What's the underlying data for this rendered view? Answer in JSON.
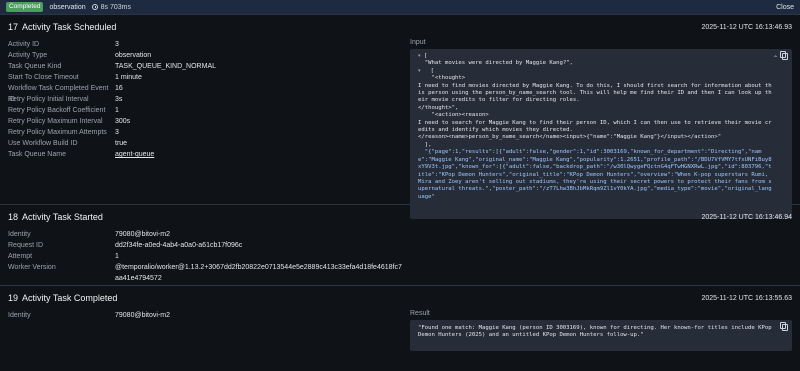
{
  "topbar": {
    "status": "Completed",
    "type": "observation",
    "duration": "8s 703ms",
    "close": "Close"
  },
  "sec17": {
    "num": "17",
    "title": "Activity Task Scheduled",
    "ts": "2025-11-12 UTC 16:13:46.93",
    "rows": [
      {
        "k": "Activity ID",
        "v": "3"
      },
      {
        "k": "Activity Type",
        "v": "observation"
      },
      {
        "k": "Task Queue Kind",
        "v": "TASK_QUEUE_KIND_NORMAL"
      },
      {
        "k": "Start To Close Timeout",
        "v": "1 minute"
      },
      {
        "k": "Workflow Task Completed Event ID",
        "v": "16"
      },
      {
        "k": "Retry Policy Initial Interval",
        "v": "3s"
      },
      {
        "k": "Retry Policy Backoff Coefficient",
        "v": "1"
      },
      {
        "k": "Retry Policy Maximum Interval",
        "v": "300s"
      },
      {
        "k": "Retry Policy Maximum Attempts",
        "v": "3"
      },
      {
        "k": "Use Workflow Build ID",
        "v": "true"
      },
      {
        "k": "Task Queue Name",
        "v": "agent-queue"
      }
    ],
    "input_label": "Input",
    "input_lines": [
      "[",
      "  \"What movies were directed by Maggie Kang?\",",
      "  [",
      "    \"<thought>",
      "I need to find movies directed by Maggie Kang. To do this, I should first search for information about this person using the person_by_name_search tool. This will help me find their ID and then I can look up their movie credits to filter for directing roles.",
      "</thought>\",",
      "    \"<action><reason>",
      "I need to search for Maggie Kang to find their person ID, which I can then use to retrieve their movie credits and identify which movies they directed.",
      "</reason><name>person_by_name_search</name><input>{\"name\":\"Maggie Kang\"}</input></action>\"",
      "  ],",
      "  \"{\"page\":1,\"results\":[{\"adult\":false,\"gender\":1,\"id\":3003169,\"known_for_department\":\"Directing\",\"name\":\"Maggie Kang\",\"original_name\":\"Maggie Kang\",\"popularity\":1.2651,\"profile_path\":\"/BDU7VfVMY7tfxUNFiBuy8xY9V3t.jpg\",\"known_for\":[{\"adult\":false,\"backdrop_path\":\"/w30lQwygeFQctnG4qFTwHGNXRwL.jpg\",\"id\":803796,\"title\":\"KPop Demon Hunters\",\"original_title\":\"KPop Demon Hunters\",\"overview\":\"When K-pop superstars Rumi, Mira and Zoey aren't selling out stadiums, they're using their secret powers to protect their fans from supernatural threats.\",\"poster_path\":\"/zT7Lhw3BhJbMkRqm9Zl1vY0kYA.jpg\",\"media_type\":\"movie\",\"original_language\""
    ]
  },
  "sec18": {
    "num": "18",
    "title": "Activity Task Started",
    "ts": "2025-11-12 UTC 16:13:46.94",
    "rows": [
      {
        "k": "Identity",
        "v": "79080@bitovi-m2"
      },
      {
        "k": "Request ID",
        "v": "dd2f34fe-a0ed-4ab4-a0a0-a61cb17f096c"
      },
      {
        "k": "Attempt",
        "v": "1"
      },
      {
        "k": "Worker Version",
        "v": "@temporalio/worker@1.13.2+3067dd2fb20822e0713544e5e2889c413c33efa4d18fe4618fc7aa41e4794572"
      }
    ]
  },
  "sec19": {
    "num": "19",
    "title": "Activity Task Completed",
    "ts": "2025-11-12 UTC 16:13:55.63",
    "rows": [
      {
        "k": "Identity",
        "v": "79080@bitovi-m2"
      }
    ],
    "result_label": "Result",
    "result_text": "\"Found one match: Maggie Kang (person ID 3003169), known for directing. Her known-for titles include KPop Demon Hunters (2025) and an untitled KPop Demon Hunters follow-up.\""
  },
  "icons": {
    "clock": "clock-icon",
    "copy": "copy-icon",
    "collapse": "chevron-up-icon",
    "expand_arrow": "chevron-down-icon"
  }
}
